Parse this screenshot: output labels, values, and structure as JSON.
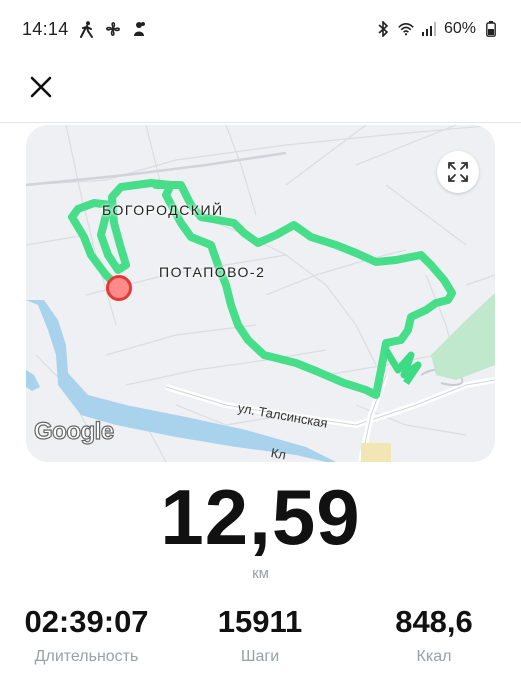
{
  "status_bar": {
    "time": "14:14",
    "left_icons": [
      "walk-icon",
      "fan-icon",
      "notification-icon"
    ],
    "battery": "60%"
  },
  "map": {
    "labels": {
      "district1": "БОГОРОДСКИЙ",
      "district2": "ПОТАПОВО-2",
      "street1": "ул. Талсинская",
      "street2": "Кл"
    },
    "provider": "Google",
    "route_color": "#3ddc84",
    "start_marker_color": "#e53935"
  },
  "summary": {
    "distance": "12,59",
    "unit": "км"
  },
  "stats": [
    {
      "value": "02:39:07",
      "label": "Длительность"
    },
    {
      "value": "15911",
      "label": "Шаги"
    },
    {
      "value": "848,6",
      "label": "Ккал"
    }
  ]
}
